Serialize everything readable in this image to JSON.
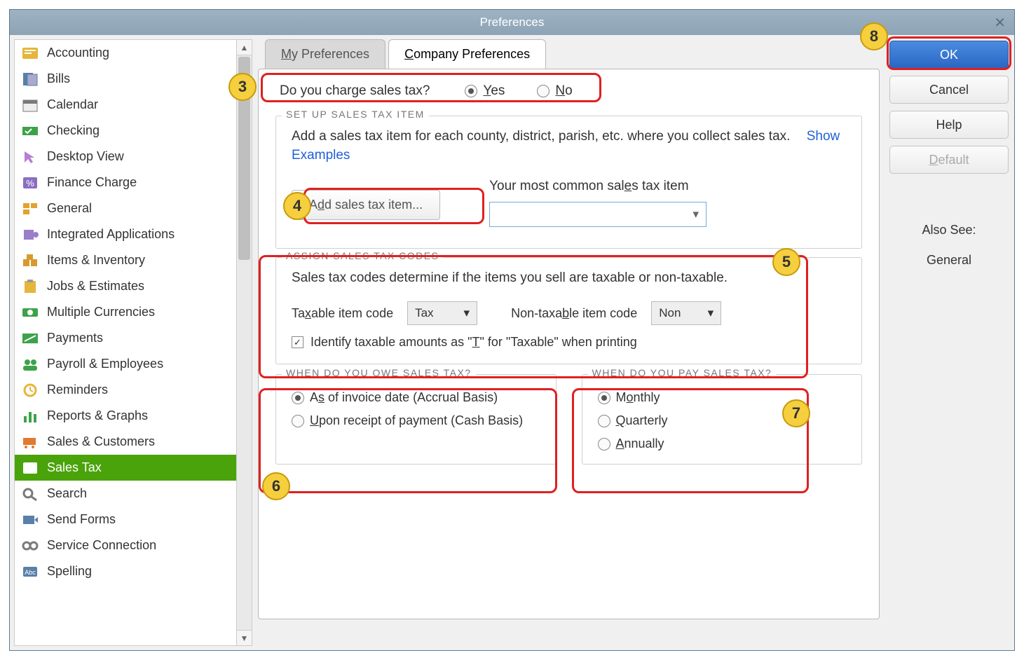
{
  "window": {
    "title": "Preferences"
  },
  "sidebar": {
    "items": [
      {
        "label": "Accounting",
        "icon": "ledger",
        "color": "#e5b63b"
      },
      {
        "label": "Bills",
        "icon": "bills",
        "color": "#5a7fa8"
      },
      {
        "label": "Calendar",
        "icon": "calendar",
        "color": "#7a7a7a"
      },
      {
        "label": "Checking",
        "icon": "check",
        "color": "#3da24a"
      },
      {
        "label": "Desktop View",
        "icon": "cursor",
        "color": "#b77dd4"
      },
      {
        "label": "Finance Charge",
        "icon": "percent",
        "color": "#8a6fc0"
      },
      {
        "label": "General",
        "icon": "blocks",
        "color": "#e2a22e"
      },
      {
        "label": "Integrated Applications",
        "icon": "puzzle",
        "color": "#9a7ec8"
      },
      {
        "label": "Items & Inventory",
        "icon": "boxes",
        "color": "#d89a2e"
      },
      {
        "label": "Jobs & Estimates",
        "icon": "clipboard",
        "color": "#e5b63b"
      },
      {
        "label": "Multiple Currencies",
        "icon": "currency",
        "color": "#3da24a"
      },
      {
        "label": "Payments",
        "icon": "money",
        "color": "#3da24a"
      },
      {
        "label": "Payroll & Employees",
        "icon": "people",
        "color": "#3da24a"
      },
      {
        "label": "Reminders",
        "icon": "clock",
        "color": "#e5b63b"
      },
      {
        "label": "Reports & Graphs",
        "icon": "bars",
        "color": "#3da24a"
      },
      {
        "label": "Sales & Customers",
        "icon": "cart",
        "color": "#e07a2e"
      },
      {
        "label": "Sales Tax",
        "icon": "tax",
        "color": "#e07a2e",
        "active": true
      },
      {
        "label": "Search",
        "icon": "search",
        "color": "#7a7a7a"
      },
      {
        "label": "Send Forms",
        "icon": "send",
        "color": "#5a7fa8"
      },
      {
        "label": "Service Connection",
        "icon": "link",
        "color": "#7a7a7a"
      },
      {
        "label": "Spelling",
        "icon": "abc",
        "color": "#5a7fa8"
      }
    ]
  },
  "tabs": {
    "my": "My Preferences",
    "company": "Company Preferences",
    "active": "company"
  },
  "charge": {
    "question": "Do you charge sales tax?",
    "yes": "Yes",
    "no": "No",
    "selected": "yes"
  },
  "setup": {
    "legend": "SET UP SALES TAX ITEM",
    "desc": "Add a sales tax item for each county, district, parish, etc. where you collect sales tax.",
    "examples": "Show Examples",
    "addBtn": "Add sales tax item...",
    "commonLabel": "Your most common sales tax item",
    "commonValue": ""
  },
  "assign": {
    "legend": "ASSIGN SALES TAX CODES",
    "desc": "Sales tax codes determine if the items you sell are taxable or non-taxable.",
    "taxableLabel": "Taxable item code",
    "taxableValue": "Tax",
    "nonTaxableLabel": "Non-taxable item code",
    "nonTaxableValue": "Non",
    "identifyLabel": "Identify taxable amounts as \"T\" for \"Taxable\" when printing",
    "identifyChecked": true
  },
  "owe": {
    "legend": "WHEN DO YOU OWE SALES TAX?",
    "opt1": "As of invoice date (Accrual Basis)",
    "opt2": "Upon receipt of payment (Cash Basis)",
    "selected": "opt1"
  },
  "pay": {
    "legend": "WHEN DO YOU PAY SALES TAX?",
    "opt1": "Monthly",
    "opt2": "Quarterly",
    "opt3": "Annually",
    "selected": "opt1"
  },
  "buttons": {
    "ok": "OK",
    "cancel": "Cancel",
    "help": "Help",
    "default": "Default"
  },
  "alsoSee": {
    "header": "Also See:",
    "link": "General"
  },
  "annotations": {
    "n3": "3",
    "n4": "4",
    "n5": "5",
    "n6": "6",
    "n7": "7",
    "n8": "8"
  }
}
